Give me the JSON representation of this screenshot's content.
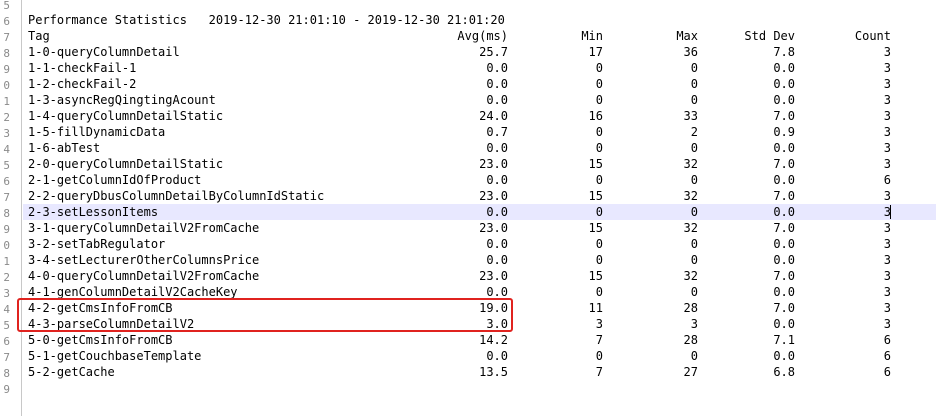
{
  "report": {
    "title": "Performance Statistics   2019-12-30 21:01:10 - 2019-12-30 21:01:20",
    "columns": {
      "tag": "Tag",
      "avg": "Avg(ms)",
      "min": "Min",
      "max": "Max",
      "std": "Std Dev",
      "count": "Count"
    },
    "rows": [
      {
        "tag": "1-0-queryColumnDetail",
        "avg": "25.7",
        "min": "17",
        "max": "36",
        "std": "7.8",
        "count": "3"
      },
      {
        "tag": "1-1-checkFail-1",
        "avg": "0.0",
        "min": "0",
        "max": "0",
        "std": "0.0",
        "count": "3"
      },
      {
        "tag": "1-2-checkFail-2",
        "avg": "0.0",
        "min": "0",
        "max": "0",
        "std": "0.0",
        "count": "3"
      },
      {
        "tag": "1-3-asyncRegQingtingAcount",
        "avg": "0.0",
        "min": "0",
        "max": "0",
        "std": "0.0",
        "count": "3"
      },
      {
        "tag": "1-4-queryColumnDetailStatic",
        "avg": "24.0",
        "min": "16",
        "max": "33",
        "std": "7.0",
        "count": "3"
      },
      {
        "tag": "1-5-fillDynamicData",
        "avg": "0.7",
        "min": "0",
        "max": "2",
        "std": "0.9",
        "count": "3"
      },
      {
        "tag": "1-6-abTest",
        "avg": "0.0",
        "min": "0",
        "max": "0",
        "std": "0.0",
        "count": "3"
      },
      {
        "tag": "2-0-queryColumnDetailStatic",
        "avg": "23.0",
        "min": "15",
        "max": "32",
        "std": "7.0",
        "count": "3"
      },
      {
        "tag": "2-1-getColumnIdOfProduct",
        "avg": "0.0",
        "min": "0",
        "max": "0",
        "std": "0.0",
        "count": "6"
      },
      {
        "tag": "2-2-queryDbusColumnDetailByColumnIdStatic",
        "avg": "23.0",
        "min": "15",
        "max": "32",
        "std": "7.0",
        "count": "3"
      },
      {
        "tag": "2-3-setLessonItems",
        "avg": "0.0",
        "min": "0",
        "max": "0",
        "std": "0.0",
        "count": "3"
      },
      {
        "tag": "3-1-queryColumnDetailV2FromCache",
        "avg": "23.0",
        "min": "15",
        "max": "32",
        "std": "7.0",
        "count": "3"
      },
      {
        "tag": "3-2-setTabRegulator",
        "avg": "0.0",
        "min": "0",
        "max": "0",
        "std": "0.0",
        "count": "3"
      },
      {
        "tag": "3-4-setLecturerOtherColumnsPrice",
        "avg": "0.0",
        "min": "0",
        "max": "0",
        "std": "0.0",
        "count": "3"
      },
      {
        "tag": "4-0-queryColumnDetailV2FromCache",
        "avg": "23.0",
        "min": "15",
        "max": "32",
        "std": "7.0",
        "count": "3"
      },
      {
        "tag": "4-1-genColumnDetailV2CacheKey",
        "avg": "0.0",
        "min": "0",
        "max": "0",
        "std": "0.0",
        "count": "3"
      },
      {
        "tag": "4-2-getCmsInfoFromCB",
        "avg": "19.0",
        "min": "11",
        "max": "28",
        "std": "7.0",
        "count": "3"
      },
      {
        "tag": "4-3-parseColumnDetailV2",
        "avg": "3.0",
        "min": "3",
        "max": "3",
        "std": "0.0",
        "count": "3"
      },
      {
        "tag": "5-0-getCmsInfoFromCB",
        "avg": "14.2",
        "min": "7",
        "max": "28",
        "std": "7.1",
        "count": "6"
      },
      {
        "tag": "5-1-getCouchbaseTemplate",
        "avg": "0.0",
        "min": "0",
        "max": "0",
        "std": "0.0",
        "count": "6"
      },
      {
        "tag": "5-2-getCache",
        "avg": "13.5",
        "min": "7",
        "max": "27",
        "std": "6.8",
        "count": "6"
      }
    ]
  },
  "gutter": {
    "line_numbers": [
      "5",
      "6",
      "7",
      "8",
      "9",
      "0",
      "1",
      "2",
      "3",
      "4",
      "5",
      "6",
      "7",
      "8",
      "9",
      "0",
      "1",
      "2",
      "3",
      "4",
      "5",
      "6",
      "7",
      "8",
      "9"
    ]
  },
  "current_line_index": 10,
  "highlight_color": "#e8e8ff",
  "annotation_color": "#e0231f"
}
